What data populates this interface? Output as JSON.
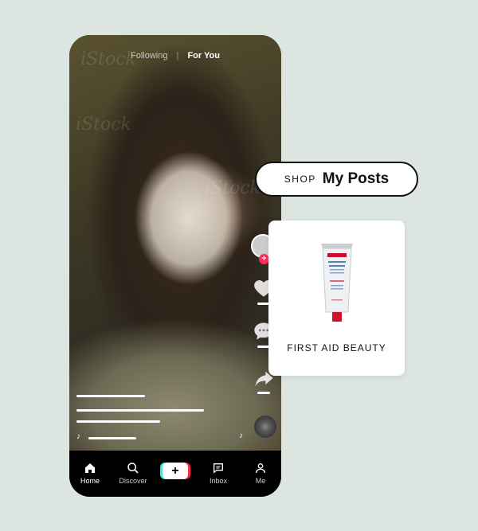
{
  "theme": {
    "background": "#dde5e0",
    "accent_red": "#fe2c55",
    "accent_cyan": "#25f4ee"
  },
  "feed": {
    "tabs": [
      {
        "label": "Following",
        "active": false
      },
      {
        "label": "For You",
        "active": true
      }
    ],
    "side_icons": [
      "profile-avatar",
      "plus-icon",
      "heart-icon",
      "comment-icon",
      "share-icon",
      "music-disc"
    ]
  },
  "bottom_nav": {
    "items": [
      {
        "label": "Home",
        "icon": "home-icon",
        "active": true
      },
      {
        "label": "Discover",
        "icon": "search-icon",
        "active": false
      },
      {
        "label": "",
        "icon": "create-plus-icon",
        "active": false
      },
      {
        "label": "Inbox",
        "icon": "inbox-icon",
        "active": false
      },
      {
        "label": "Me",
        "icon": "profile-icon",
        "active": false
      }
    ],
    "create_symbol": "+"
  },
  "shop_banner": {
    "prefix": "SHOP",
    "title": "My Posts"
  },
  "product": {
    "brand": "FIRST AID BEAUTY",
    "icon": "cream-tube-icon"
  }
}
